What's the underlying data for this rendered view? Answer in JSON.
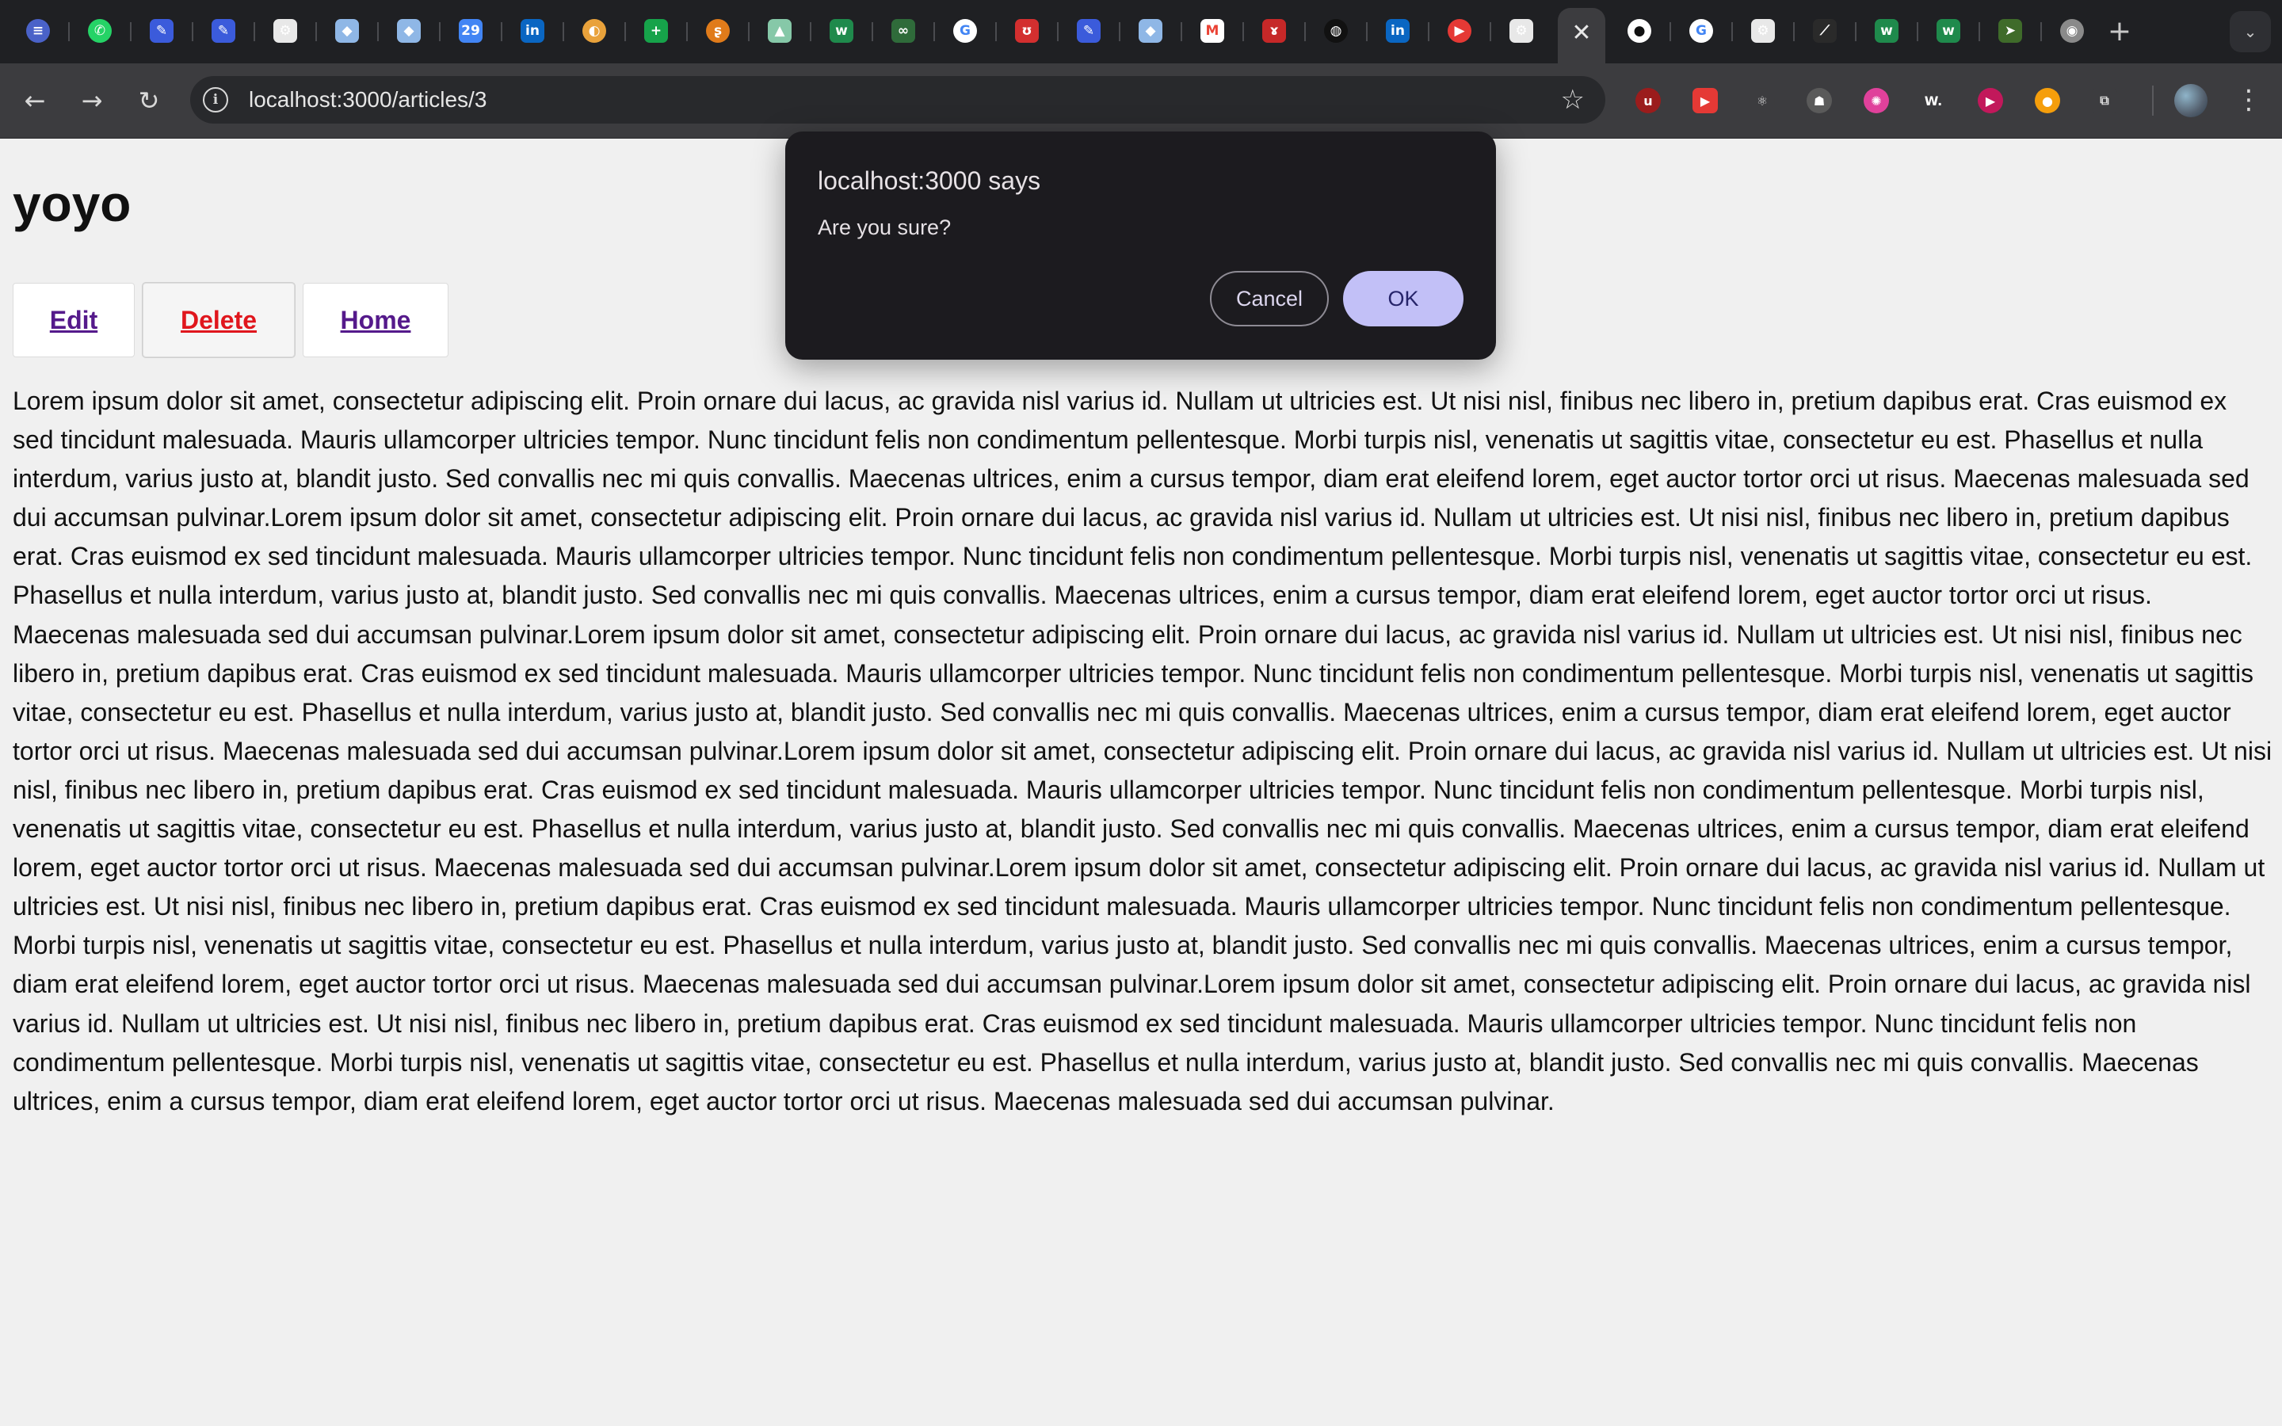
{
  "browser": {
    "tabs": [
      {
        "name": "tab-icon-blue-circle",
        "glyph": "≡",
        "bg": "#4a62c8",
        "circle": true
      },
      {
        "name": "whatsapp-icon",
        "glyph": "✆",
        "bg": "#25d366",
        "circle": true
      },
      {
        "name": "pen-icon",
        "glyph": "✎",
        "bg": "#3b5bdb",
        "circle": false
      },
      {
        "name": "pen-icon-2",
        "glyph": "✎",
        "bg": "#3b5bdb",
        "circle": false
      },
      {
        "name": "openai-icon",
        "glyph": "⚙",
        "bg": "#e8e8e8",
        "circle": false
      },
      {
        "name": "box-icon",
        "glyph": "◆",
        "bg": "#8fb7e6",
        "circle": false
      },
      {
        "name": "box-icon-2",
        "glyph": "◆",
        "bg": "#8fb7e6",
        "circle": false
      },
      {
        "name": "calendar-icon",
        "glyph": "29",
        "bg": "#4285f4",
        "circle": false
      },
      {
        "name": "linkedin-icon",
        "glyph": "in",
        "bg": "#0a66c2",
        "circle": false
      },
      {
        "name": "sun-icon",
        "glyph": "◐",
        "bg": "#e9a23b",
        "circle": true
      },
      {
        "name": "sheets-plus-icon",
        "glyph": "+",
        "bg": "#16a34a",
        "circle": false
      },
      {
        "name": "swirl-icon",
        "glyph": "ʂ",
        "bg": "#e07b1a",
        "circle": true
      },
      {
        "name": "mountain-icon",
        "glyph": "▲",
        "bg": "#86c8a8",
        "circle": false
      },
      {
        "name": "w-icon",
        "glyph": "w",
        "bg": "#1f8a4c",
        "circle": false
      },
      {
        "name": "infinity-icon",
        "glyph": "∞",
        "bg": "#2f6b3a",
        "circle": false
      },
      {
        "name": "google-icon",
        "glyph": "G",
        "bg": "#ffffff",
        "circle": true,
        "fg": "#4285f4"
      },
      {
        "name": "mask-icon",
        "glyph": "ʊ",
        "bg": "#d32f2f",
        "circle": false
      },
      {
        "name": "pen-icon-3",
        "glyph": "✎",
        "bg": "#3b5bdb",
        "circle": false
      },
      {
        "name": "box-icon-3",
        "glyph": "◆",
        "bg": "#8fb7e6",
        "circle": false
      },
      {
        "name": "gmail-icon",
        "glyph": "M",
        "bg": "#ffffff",
        "circle": false,
        "fg": "#ea4335"
      },
      {
        "name": "bird-icon",
        "glyph": "ɤ",
        "bg": "#c62828",
        "circle": false
      },
      {
        "name": "chatgpt-icon",
        "glyph": "◍",
        "bg": "#111111",
        "circle": true
      },
      {
        "name": "linkedin-icon-2",
        "glyph": "in",
        "bg": "#0a66c2",
        "circle": false
      },
      {
        "name": "youtube-play-icon",
        "glyph": "▶",
        "bg": "#e53935",
        "circle": true
      },
      {
        "name": "openai-icon-2",
        "glyph": "⚙",
        "bg": "#e8e8e8",
        "circle": false
      }
    ],
    "tabs_after": [
      {
        "name": "github-icon",
        "glyph": "●",
        "bg": "#ffffff",
        "circle": true,
        "fg": "#111111"
      },
      {
        "name": "google-icon-2",
        "glyph": "G",
        "bg": "#ffffff",
        "circle": true,
        "fg": "#4285f4"
      },
      {
        "name": "openai-icon-3",
        "glyph": "⚙",
        "bg": "#e8e8e8",
        "circle": false
      },
      {
        "name": "slash-icon",
        "glyph": "⟋",
        "bg": "#2a2a2a",
        "circle": false
      },
      {
        "name": "w-icon-2",
        "glyph": "w",
        "bg": "#1f8a4c",
        "circle": false
      },
      {
        "name": "w-icon-3",
        "glyph": "w",
        "bg": "#1f8a4c",
        "circle": false
      },
      {
        "name": "cursor-icon",
        "glyph": "➤",
        "bg": "#3f6b2a",
        "circle": false
      },
      {
        "name": "chrome-icon",
        "glyph": "◉",
        "bg": "#8a8a8a",
        "circle": true
      }
    ],
    "active_tab_close": "✕",
    "new_tab": "+",
    "tab_search": "⌄",
    "back": "←",
    "forward": "→",
    "reload": "↻",
    "site_info": "i",
    "url": "localhost:3000/articles/3",
    "bookmark_star": "☆",
    "extensions": [
      {
        "name": "ublock-icon",
        "glyph": "u",
        "bg": "#9b1c1c",
        "circle": true
      },
      {
        "name": "youtube-ext-icon",
        "glyph": "▶",
        "bg": "#e53935",
        "circle": false
      },
      {
        "name": "react-icon",
        "glyph": "⚛",
        "bg": "#3c3c3f",
        "circle": true,
        "fg": "#dddddd"
      },
      {
        "name": "robot-icon",
        "glyph": "☗",
        "bg": "#5a5a5a",
        "circle": true
      },
      {
        "name": "color-wheel-icon",
        "glyph": "✺",
        "bg": "#e0419b",
        "circle": true
      },
      {
        "name": "w-ext-icon",
        "glyph": "W.",
        "bg": "#3c3c3f",
        "circle": false,
        "fg": "#ffffff"
      },
      {
        "name": "play-circle-icon",
        "glyph": "▶",
        "bg": "#c2185b",
        "circle": true
      },
      {
        "name": "capsule-icon",
        "glyph": "●",
        "bg": "#f59e0b",
        "circle": true
      },
      {
        "name": "puzzle-icon",
        "glyph": "⧉",
        "bg": "#3c3c3f",
        "circle": false,
        "fg": "#dddddd"
      }
    ],
    "menu": "⋮"
  },
  "page": {
    "title": "yoyo",
    "edit_label": "Edit",
    "delete_label": "Delete",
    "home_label": "Home",
    "body": "Lorem ipsum dolor sit amet, consectetur adipiscing elit. Proin ornare dui lacus, ac gravida nisl varius id. Nullam ut ultricies est. Ut nisi nisl, finibus nec libero in, pretium dapibus erat. Cras euismod ex sed tincidunt malesuada. Mauris ullamcorper ultricies tempor. Nunc tincidunt felis non condimentum pellentesque. Morbi turpis nisl, venenatis ut sagittis vitae, consectetur eu est. Phasellus et nulla interdum, varius justo at, blandit justo. Sed convallis nec mi quis convallis. Maecenas ultrices, enim a cursus tempor, diam erat eleifend lorem, eget auctor tortor orci ut risus. Maecenas malesuada sed dui accumsan pulvinar.Lorem ipsum dolor sit amet, consectetur adipiscing elit. Proin ornare dui lacus, ac gravida nisl varius id. Nullam ut ultricies est. Ut nisi nisl, finibus nec libero in, pretium dapibus erat. Cras euismod ex sed tincidunt malesuada. Mauris ullamcorper ultricies tempor. Nunc tincidunt felis non condimentum pellentesque. Morbi turpis nisl, venenatis ut sagittis vitae, consectetur eu est. Phasellus et nulla interdum, varius justo at, blandit justo. Sed convallis nec mi quis convallis. Maecenas ultrices, enim a cursus tempor, diam erat eleifend lorem, eget auctor tortor orci ut risus. Maecenas malesuada sed dui accumsan pulvinar.Lorem ipsum dolor sit amet, consectetur adipiscing elit. Proin ornare dui lacus, ac gravida nisl varius id. Nullam ut ultricies est. Ut nisi nisl, finibus nec libero in, pretium dapibus erat. Cras euismod ex sed tincidunt malesuada. Mauris ullamcorper ultricies tempor. Nunc tincidunt felis non condimentum pellentesque. Morbi turpis nisl, venenatis ut sagittis vitae, consectetur eu est. Phasellus et nulla interdum, varius justo at, blandit justo. Sed convallis nec mi quis convallis. Maecenas ultrices, enim a cursus tempor, diam erat eleifend lorem, eget auctor tortor orci ut risus. Maecenas malesuada sed dui accumsan pulvinar.Lorem ipsum dolor sit amet, consectetur adipiscing elit. Proin ornare dui lacus, ac gravida nisl varius id. Nullam ut ultricies est. Ut nisi nisl, finibus nec libero in, pretium dapibus erat. Cras euismod ex sed tincidunt malesuada. Mauris ullamcorper ultricies tempor. Nunc tincidunt felis non condimentum pellentesque. Morbi turpis nisl, venenatis ut sagittis vitae, consectetur eu est. Phasellus et nulla interdum, varius justo at, blandit justo. Sed convallis nec mi quis convallis. Maecenas ultrices, enim a cursus tempor, diam erat eleifend lorem, eget auctor tortor orci ut risus. Maecenas malesuada sed dui accumsan pulvinar.Lorem ipsum dolor sit amet, consectetur adipiscing elit. Proin ornare dui lacus, ac gravida nisl varius id. Nullam ut ultricies est. Ut nisi nisl, finibus nec libero in, pretium dapibus erat. Cras euismod ex sed tincidunt malesuada. Mauris ullamcorper ultricies tempor. Nunc tincidunt felis non condimentum pellentesque. Morbi turpis nisl, venenatis ut sagittis vitae, consectetur eu est. Phasellus et nulla interdum, varius justo at, blandit justo. Sed convallis nec mi quis convallis. Maecenas ultrices, enim a cursus tempor, diam erat eleifend lorem, eget auctor tortor orci ut risus. Maecenas malesuada sed dui accumsan pulvinar.Lorem ipsum dolor sit amet, consectetur adipiscing elit. Proin ornare dui lacus, ac gravida nisl varius id. Nullam ut ultricies est. Ut nisi nisl, finibus nec libero in, pretium dapibus erat. Cras euismod ex sed tincidunt malesuada. Mauris ullamcorper ultricies tempor. Nunc tincidunt felis non condimentum pellentesque. Morbi turpis nisl, venenatis ut sagittis vitae, consectetur eu est. Phasellus et nulla interdum, varius justo at, blandit justo. Sed convallis nec mi quis convallis. Maecenas ultrices, enim a cursus tempor, diam erat eleifend lorem, eget auctor tortor orci ut risus. Maecenas malesuada sed dui accumsan pulvinar."
  },
  "dialog": {
    "title": "localhost:3000 says",
    "message": "Are you sure?",
    "cancel_label": "Cancel",
    "ok_label": "OK"
  }
}
